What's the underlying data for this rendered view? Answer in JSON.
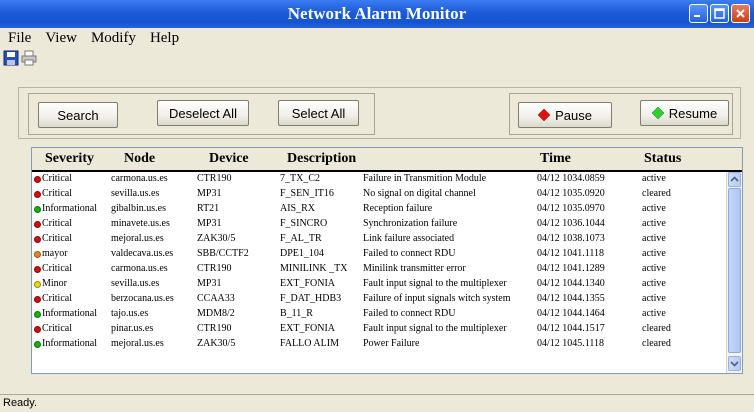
{
  "window": {
    "title": "Network Alarm Monitor"
  },
  "menu": {
    "file": "File",
    "view": "View",
    "modify": "Modify",
    "help": "Help"
  },
  "toolbar_icons": [
    "save-icon",
    "print-icon"
  ],
  "buttons": {
    "search": "Search",
    "deselect_all": "Deselect All",
    "select_all": "Select All",
    "pause": "Pause",
    "resume": "Resume"
  },
  "table": {
    "headers": {
      "severity": "Severity",
      "node": "Node",
      "device": "Device",
      "description": "Description",
      "time": "Time",
      "status": "Status"
    },
    "rows": [
      {
        "severity": "Critical",
        "color": "#d01010",
        "node": "carmona.us.es",
        "device": "CTR190",
        "code": "7_TX_C2",
        "description": "Failure in Transmition Module",
        "time": "04/12 1034.0859",
        "status": "active"
      },
      {
        "severity": "Critical",
        "color": "#d01010",
        "node": "sevilla.us.es",
        "device": "MP31",
        "code": "F_SEN_IT16",
        "description": "No signal on digital channel",
        "time": "04/12 1035.0920",
        "status": "cleared"
      },
      {
        "severity": "Informational",
        "color": "#18b018",
        "node": "gibalbin.us.es",
        "device": "RT21",
        "code": "AIS_RX",
        "description": "Reception failure",
        "time": "04/12 1035.0970",
        "status": "active"
      },
      {
        "severity": "Critical",
        "color": "#d01010",
        "node": "minavete.us.es",
        "device": "MP31",
        "code": "F_SINCRO",
        "description": "Synchronization failure",
        "time": "04/12 1036.1044",
        "status": "active"
      },
      {
        "severity": "Critical",
        "color": "#d01010",
        "node": "mejoral.us.es",
        "device": "ZAK30/5",
        "code": "F_AL_TR",
        "description": "Link failure associated",
        "time": "04/12 1038.1073",
        "status": "active"
      },
      {
        "severity": "mayor",
        "color": "#e08a1a",
        "node": "valdecava.us.es",
        "device": "SBB/CCTF2",
        "code": "DPE1_104",
        "description": "Failed to connect RDU",
        "time": "04/12 1041.1118",
        "status": "active"
      },
      {
        "severity": "Critical",
        "color": "#d01010",
        "node": "carmona.us.es",
        "device": "CTR190",
        "code": "MINILINK _TX",
        "description": "Minilink transmitter error",
        "time": "04/12 1041.1289",
        "status": "active"
      },
      {
        "severity": "Minor",
        "color": "#e8d818",
        "node": "sevilla.us.es",
        "device": "MP31",
        "code": "EXT_FONIA",
        "description": "Fault input signal to the multiplexer",
        "time": "04/12 1044.1340",
        "status": "active"
      },
      {
        "severity": "Critical",
        "color": "#d01010",
        "node": "berzocana.us.es",
        "device": "CCAA33",
        "code": "F_DAT_HDB3",
        "description": "Failure of input signals witch system",
        "time": "04/12 1044.1355",
        "status": "active"
      },
      {
        "severity": "Informational",
        "color": "#18b018",
        "node": "tajo.us.es",
        "device": "MDM8/2",
        "code": "B_11_R",
        "description": "Failed to connect RDU",
        "time": "04/12 1044.1464",
        "status": "active"
      },
      {
        "severity": "Critical",
        "color": "#d01010",
        "node": "pinar.us.es",
        "device": "CTR190",
        "code": "EXT_FONIA",
        "description": "Fault input signal to the multiplexer",
        "time": "04/12 1044.1517",
        "status": "cleared"
      },
      {
        "severity": "Informational",
        "color": "#18b018",
        "node": "mejoral.us.es",
        "device": "ZAK30/5",
        "code": "FALLO ALIM",
        "description": "Power Failure",
        "time": "04/12 1045.1118",
        "status": "cleared"
      }
    ]
  },
  "status_bar": {
    "text": "Ready."
  }
}
